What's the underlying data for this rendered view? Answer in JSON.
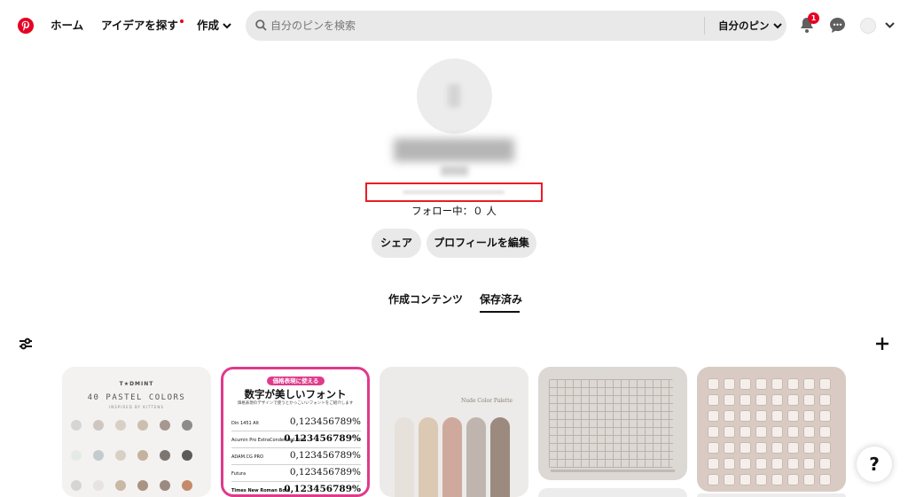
{
  "header": {
    "logo_icon": "pinterest-logo",
    "nav_home": "ホーム",
    "nav_explore": "アイデアを探す",
    "nav_create": "作成",
    "search_placeholder": "自分のピンを検索",
    "search_scope": "自分のピン",
    "notification_count": "1",
    "brand_color": "#e60023"
  },
  "profile": {
    "following_text": "フォロー中：０ 人",
    "share_button": "シェア",
    "edit_profile_button": "プロフィールを編集"
  },
  "tabs": {
    "created": "作成コンテンツ",
    "saved": "保存済み",
    "active": "saved"
  },
  "pins": {
    "pin1": {
      "brand": "T★DMINT",
      "title": "40 PASTEL COLORS",
      "subtitle": "INSPIRED BY KITTENS",
      "swatches": [
        "#d7d5d2",
        "#cfc7bf",
        "#d9cfc4",
        "#cdbfae",
        "#a69890",
        "#8f8b89",
        "#e4ebe7",
        "#c3cbce",
        "#d9cfc4",
        "#c5b29e",
        "#7c7572",
        "#5e5a5a",
        "#d7d5d2",
        "#e8e2e1",
        "#c9b8a6",
        "#a99382",
        "#9c8a80",
        "#c48a6a"
      ]
    },
    "pin2": {
      "tag": "価格表現に使える",
      "title": "数字が美しいフォント",
      "subtitle": "価格表現のデザインで使うとかっこいいフォントをご紹介します",
      "rows": [
        {
          "font": "Din 1451 Alt",
          "nums": "0,123456789%"
        },
        {
          "font": "Acumin Pro ExtraCondensed Bold",
          "nums": "0,123456789%"
        },
        {
          "font": "ADAM.CG PRO",
          "nums": "0,123456789%"
        },
        {
          "font": "Futura",
          "nums": "0,123456789%"
        },
        {
          "font": "Times New Roman Bold",
          "nums": "0,123456789%"
        }
      ]
    },
    "pin3": {
      "title": "Nude Color Palette",
      "stripes": [
        "#e6e1da",
        "#dcc9b4",
        "#cfaa9c",
        "#bfb5ae",
        "#9c8a7f"
      ]
    }
  },
  "help_label": "?"
}
